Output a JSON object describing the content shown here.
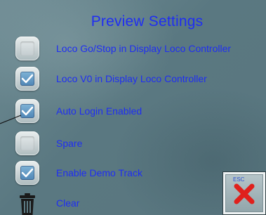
{
  "title": "Preview Settings",
  "colors": {
    "text": "#1f2ef2",
    "check_fill": "#4f86b6",
    "esc_x": "#e0201c"
  },
  "settings": [
    {
      "label": "Loco Go/Stop in Display Loco Controller",
      "checked": false
    },
    {
      "label": "Loco V0 in Display Loco Controller",
      "checked": true
    },
    {
      "label": "Auto Login Enabled",
      "checked": true
    },
    {
      "label": "Spare",
      "checked": false
    },
    {
      "label": "Enable Demo Track",
      "checked": true
    }
  ],
  "clear": {
    "label": "Clear",
    "icon": "trash-icon"
  },
  "esc_button": {
    "label": "ESC",
    "icon": "close-x-icon"
  }
}
